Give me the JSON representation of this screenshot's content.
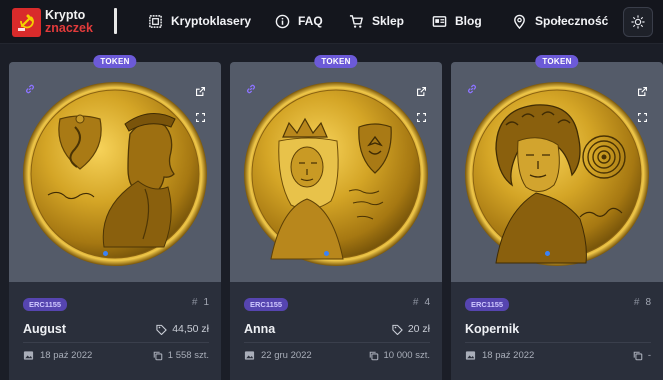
{
  "logo": {
    "line1": "Krypto",
    "line2": "znaczek"
  },
  "nav": [
    {
      "label": "Kryptoklasery",
      "icon": "stamp-album-icon"
    },
    {
      "label": "FAQ",
      "icon": "info-icon"
    },
    {
      "label": "Sklep",
      "icon": "cart-icon"
    },
    {
      "label": "Blog",
      "icon": "blog-icon"
    },
    {
      "label": "Społeczność",
      "icon": "location-pin-icon"
    }
  ],
  "theme_toggle": {
    "icon": "sun-icon"
  },
  "cards": [
    {
      "badge": "TOKEN",
      "standard": "ERC1155",
      "number": "1",
      "name": "August",
      "price": "44,50 zł",
      "date": "18 paź 2022",
      "supply": "1 558 szt."
    },
    {
      "badge": "TOKEN",
      "standard": "ERC1155",
      "number": "4",
      "name": "Anna",
      "price": "20 zł",
      "date": "22 gru 2022",
      "supply": "10 000 szt."
    },
    {
      "badge": "TOKEN",
      "standard": "ERC1155",
      "number": "8",
      "name": "Kopernik",
      "price": "",
      "date": "18 paź 2022",
      "supply": "-"
    }
  ],
  "colors": {
    "accent": "#6c5ad8",
    "brand_red": "#d92b2b",
    "coin_gold": "#d4a526"
  }
}
